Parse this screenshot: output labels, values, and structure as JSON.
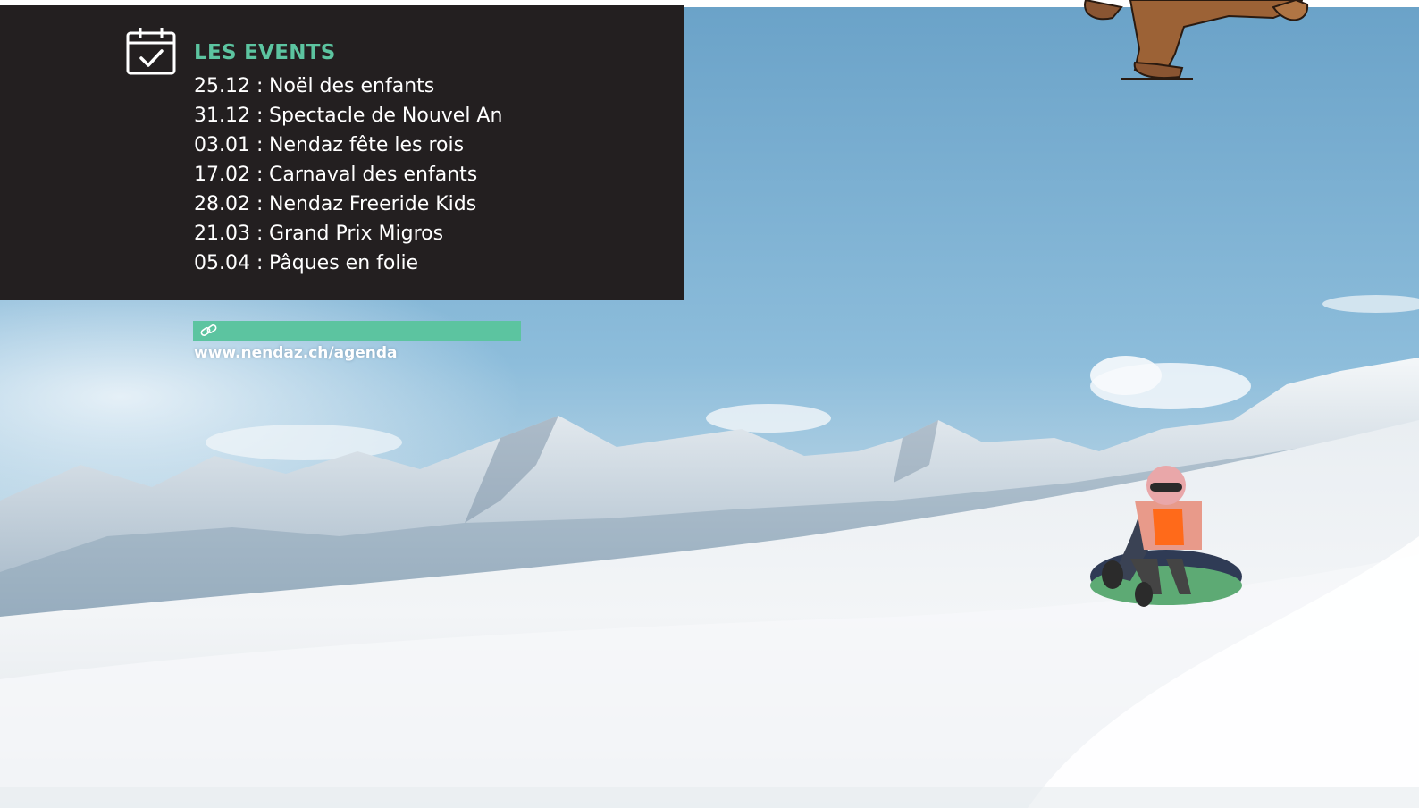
{
  "events": {
    "title": "LES EVENTS",
    "icon": "calendar-check-icon",
    "items": [
      {
        "date": "25.12 :",
        "name": "Noël des enfants"
      },
      {
        "date": "31.12 :",
        "name": "Spectacle de Nouvel An"
      },
      {
        "date": "03.01 :",
        "name": "Nendaz fête les rois"
      },
      {
        "date": "17.02 :",
        "name": "Carnaval des enfants"
      },
      {
        "date": "28.02 :",
        "name": "Nendaz Freeride Kids"
      },
      {
        "date": "21.03 :",
        "name": "Grand Prix Migros"
      },
      {
        "date": "05.04 :",
        "name": "Pâques en folie"
      }
    ]
  },
  "link": {
    "icon": "link-icon",
    "url_text": "www.nendaz.ch/agenda"
  },
  "colors": {
    "panel_bg": "#231f20",
    "accent_green": "#5cc4a0",
    "sky": "#7fb1d3",
    "snow": "#f2f4f6"
  }
}
